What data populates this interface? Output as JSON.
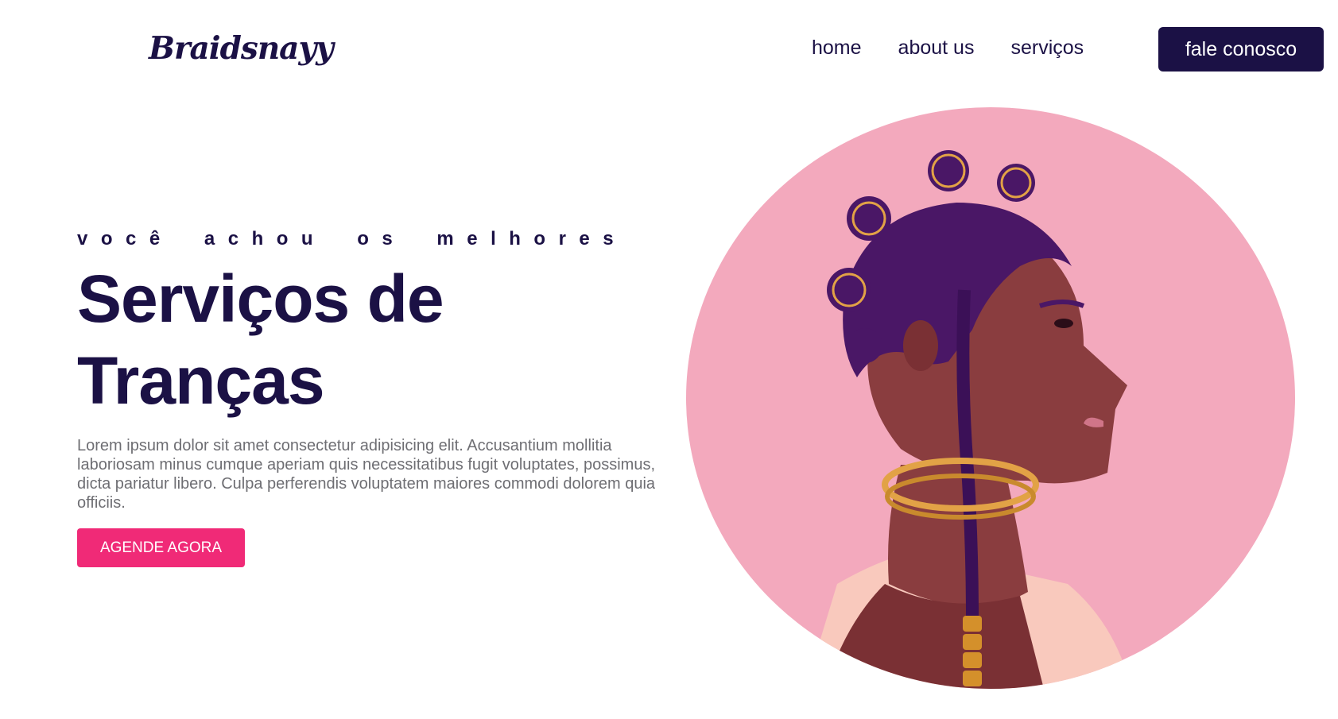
{
  "brand": {
    "logo_text": "Braidsnayy",
    "color_primary": "#1b1145",
    "color_accent": "#f02a77",
    "color_circle": "#f3a9bd"
  },
  "nav": {
    "links": [
      {
        "label": "home"
      },
      {
        "label": "about us"
      },
      {
        "label": "serviços"
      }
    ],
    "cta_label": "fale conosco"
  },
  "hero": {
    "tagline": "você achou os melhores",
    "headline_line1": "Serviços de",
    "headline_line2": "Tranças",
    "description": "Lorem ipsum dolor sit amet consectetur adipisicing elit. Accusantium mollitia laboriosam minus cumque aperiam quis necessitatibus fugit voluptates, possimus, dicta pariatur libero. Culpa perferendis voluptatem maiores commodi dolorem quia officiis.",
    "cta_label": "AGENDE AGORA",
    "image_subject": "illustration-woman-with-braids"
  }
}
